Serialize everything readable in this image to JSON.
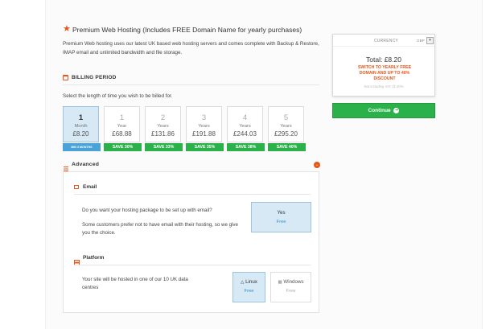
{
  "product": {
    "title": "Premium Web Hosting (Includes FREE Domain Name for yearly purchases)",
    "description": "Premium Web hosting uses our latest UK based web hosting servers and comes complete with Backup & Restore, IMAP email and unlimited bandwidth and file storage."
  },
  "billing": {
    "heading": "BILLING PERIOD",
    "instruction": "Select the length of time you wish to be billed for.",
    "periods": [
      {
        "num": "1",
        "unit": "Month",
        "price": "£8.20",
        "badge": "MIN 3 MONTHS"
      },
      {
        "num": "1",
        "unit": "Year",
        "price": "£68.88",
        "badge": "SAVE 30%"
      },
      {
        "num": "2",
        "unit": "Years",
        "price": "£131.86",
        "badge": "SAVE 33%"
      },
      {
        "num": "3",
        "unit": "Years",
        "price": "£191.88",
        "badge": "SAVE 35%"
      },
      {
        "num": "4",
        "unit": "Years",
        "price": "£244.03",
        "badge": "SAVE 38%"
      },
      {
        "num": "5",
        "unit": "Years",
        "price": "£295.20",
        "badge": "SAVE 40%"
      }
    ],
    "selected_index": 0
  },
  "advanced": {
    "heading": "Advanced",
    "email": {
      "heading": "Email",
      "question": "Do you want your hosting package to be set up with email?",
      "note": "Some customers prefer not to have email with their hosting, so we give you the choice.",
      "option_yes": "Yes",
      "option_yes_price": "Free"
    },
    "platform": {
      "heading": "Platform",
      "text": "Your site will be hosted in one of our 10 UK data centres",
      "linux_label": "Linux",
      "linux_price": "Free",
      "windows_label": "Windows",
      "windows_price": "Free",
      "selected": "Linux"
    }
  },
  "summary": {
    "currency_label": "CURRENCY",
    "currency_code": "GBP",
    "total": "Total: £8.20",
    "promo": "SWITCH TO YEARLY FREE DOMAIN AND UP TO 40% DISCOUNT",
    "vat_note": "Not including VAT @ 20%"
  },
  "continue_label": "Continue",
  "colors": {
    "accent_orange": "#e8561a",
    "save_green": "#2ab14a",
    "min_blue": "#4aa3d8",
    "selected_bg": "#d6e9f4",
    "selected_border": "#9cc6df"
  },
  "icons": [
    "star-icon",
    "calendar-icon",
    "sliders-icon",
    "chevron-down-circle-icon",
    "envelope-icon",
    "server-icon",
    "linux-icon",
    "windows-icon",
    "arrow-right-circle-icon",
    "dropdown-arrow-icon"
  ]
}
